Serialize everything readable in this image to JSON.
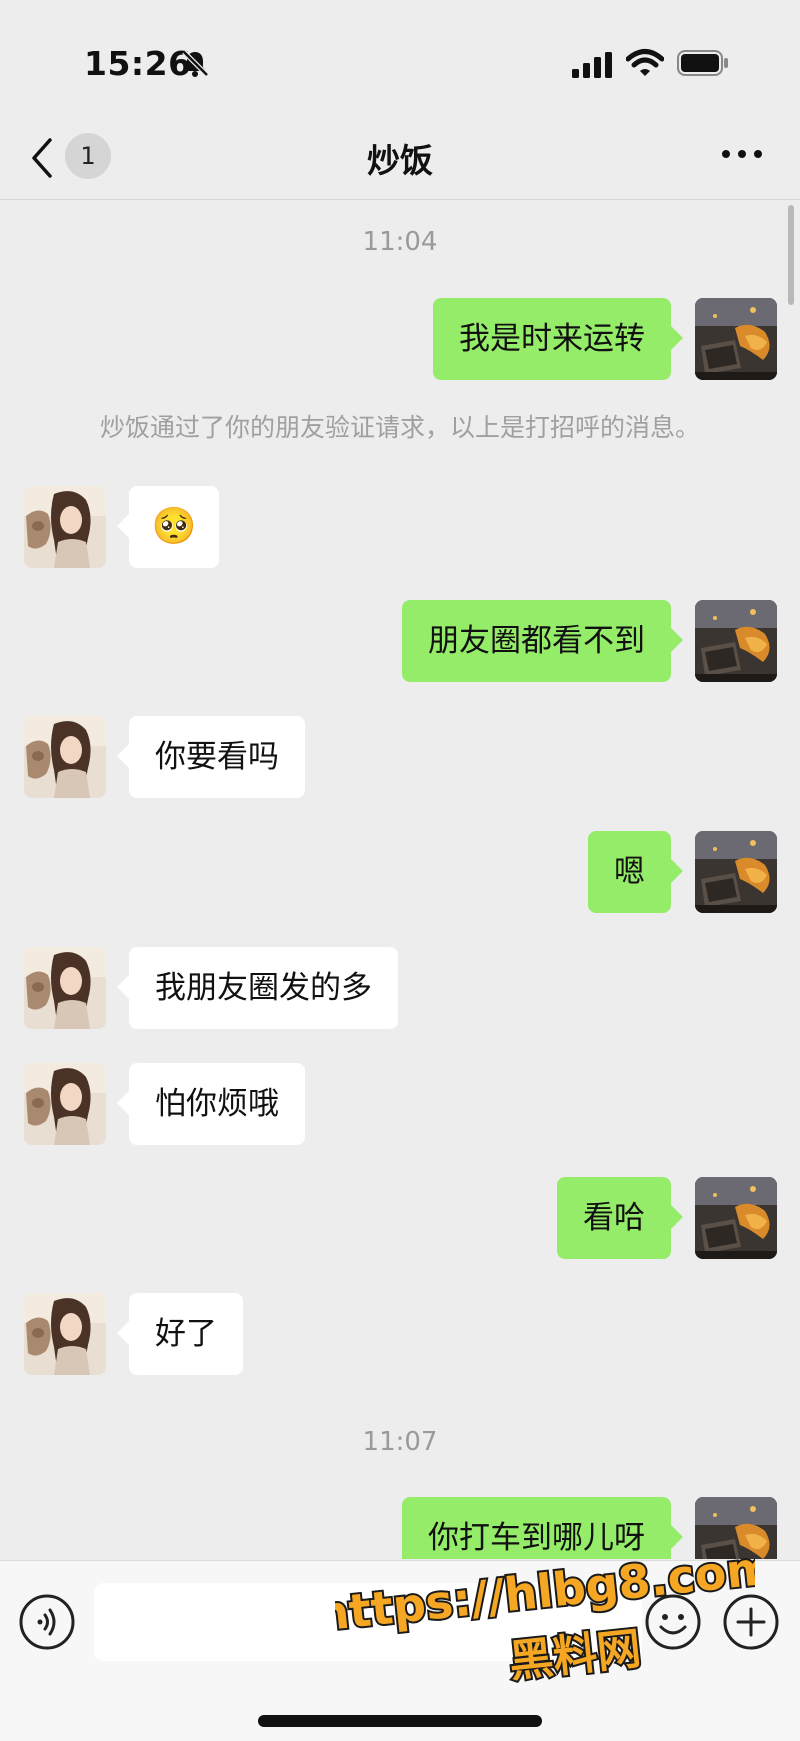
{
  "status_bar": {
    "time": "15:26"
  },
  "nav": {
    "unread_count": "1",
    "title": "炒饭"
  },
  "colors": {
    "outgoing_bubble": "#95ec69",
    "incoming_bubble": "#ffffff",
    "background": "#ededed",
    "watermark": "#f5a623"
  },
  "icons": {
    "bell": "bell-slash-icon",
    "signal": "signal-icon",
    "wifi": "wifi-icon",
    "battery": "battery-icon",
    "back": "chevron-left-icon",
    "more": "more-icon",
    "voice": "voice-icon",
    "emoji": "emoji-icon",
    "plus": "plus-icon"
  },
  "messages": {
    "time_1": "11:04",
    "m1": "我是时来运转",
    "system": "炒饭通过了你的朋友验证请求，以上是打招呼的消息。",
    "m2_emoji": "🥺",
    "m3": "朋友圈都看不到",
    "m4": "你要看吗",
    "m5": "嗯",
    "m6": "我朋友圈发的多",
    "m7": "怕你烦哦",
    "m8": "看哈",
    "m9": "好了",
    "time_2": "11:07",
    "m10": "你打车到哪儿呀"
  },
  "input": {
    "placeholder": ""
  },
  "watermark": {
    "url": "https://hlbg8.com",
    "name": "黑料网"
  }
}
